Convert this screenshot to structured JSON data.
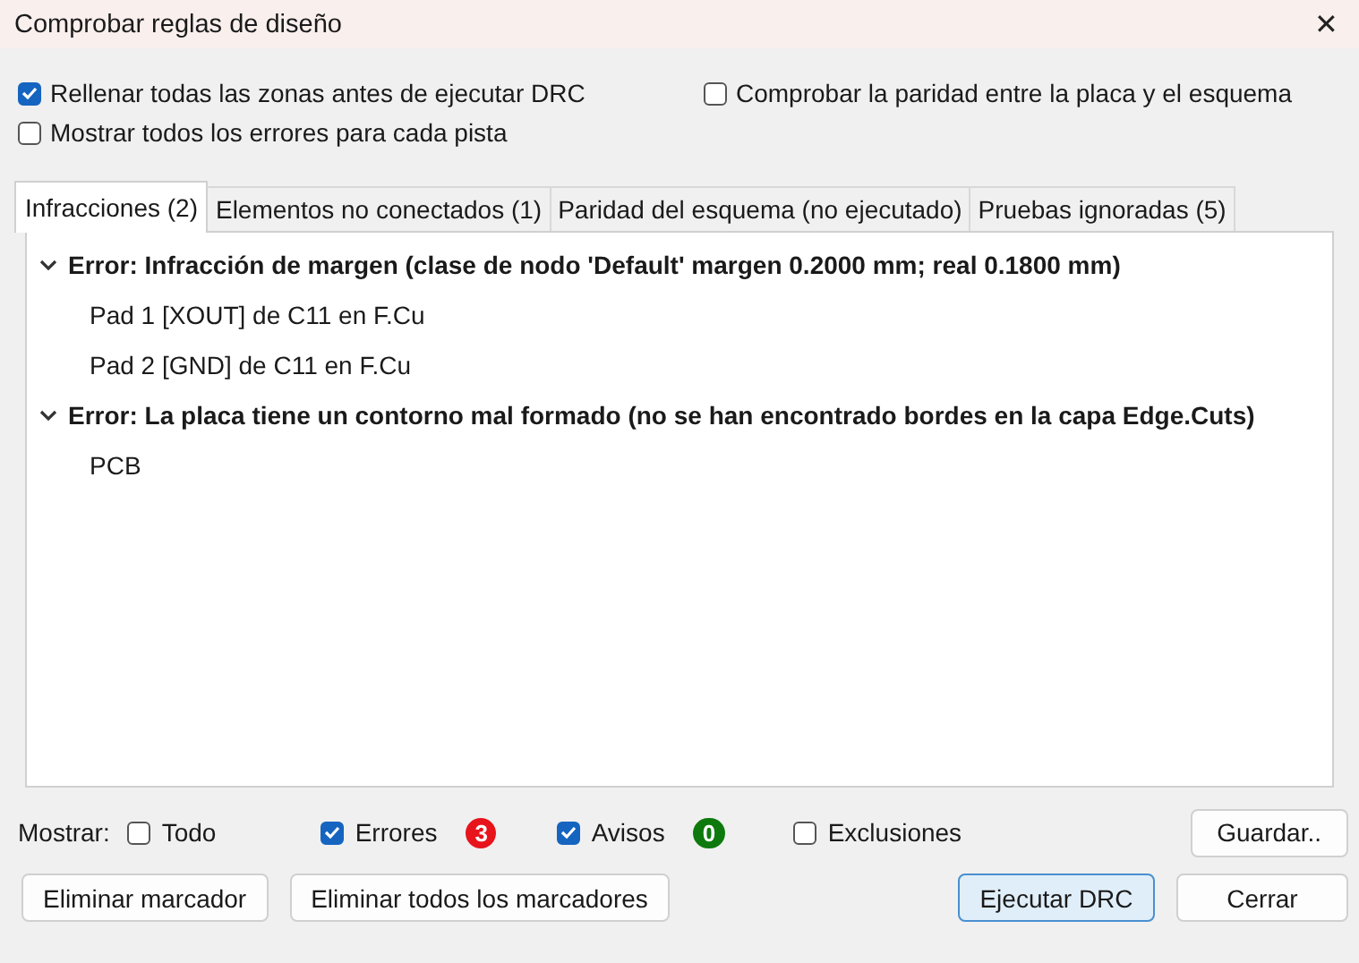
{
  "window": {
    "title": "Comprobar reglas de diseño",
    "close": "✕"
  },
  "options": [
    {
      "label": "Rellenar todas las zonas antes de ejecutar DRC",
      "checked": true
    },
    {
      "label": "Comprobar la paridad entre la placa y el esquema",
      "checked": false
    },
    {
      "label": "Mostrar todos los errores para cada pista",
      "checked": false
    }
  ],
  "tabs": [
    {
      "label": "Infracciones (2)",
      "selected": true
    },
    {
      "label": "Elementos no conectados (1)",
      "selected": false
    },
    {
      "label": "Paridad del esquema (no ejecutado)",
      "selected": false
    },
    {
      "label": "Pruebas ignoradas (5)",
      "selected": false
    }
  ],
  "tree": [
    {
      "label": "Error: Infracción de margen (clase de nodo 'Default' margen 0.2000 mm; real 0.1800 mm)",
      "expanded": true,
      "children": [
        {
          "label": "Pad 1 [XOUT] de C11 en F.Cu"
        },
        {
          "label": "Pad 2 [GND] de C11 en F.Cu"
        }
      ]
    },
    {
      "label": "Error: La placa tiene un contorno mal formado (no se han encontrado bordes en la capa Edge.Cuts)",
      "expanded": true,
      "children": [
        {
          "label": "PCB"
        }
      ]
    }
  ],
  "filter": {
    "label": "Mostrar:",
    "items": [
      {
        "label": "Todo",
        "checked": false
      },
      {
        "label": "Errores",
        "checked": true,
        "badge": "3",
        "color": "#e8141c"
      },
      {
        "label": "Avisos",
        "checked": true,
        "badge": "0",
        "color": "#0e7a0d"
      },
      {
        "label": "Exclusiones",
        "checked": false
      }
    ]
  },
  "save_button": "Guardar..",
  "buttons_left": [
    "Eliminar marcador",
    "Eliminar todos los marcadores"
  ],
  "buttons_right": [
    {
      "label": "Ejecutar DRC",
      "selected": true
    },
    {
      "label": "Cerrar",
      "selected": false
    }
  ]
}
